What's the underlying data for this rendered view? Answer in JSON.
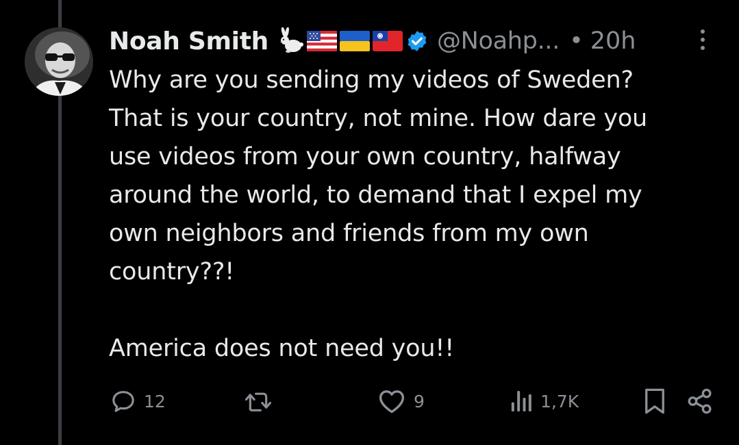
{
  "author": {
    "display_name": "Noah Smith",
    "handle": "@Noahp...",
    "separator": "•",
    "timestamp": "20h",
    "badges": [
      "rabbit-emoji",
      "us-flag",
      "ukraine-flag",
      "taiwan-flag",
      "verified-icon"
    ]
  },
  "tweet": {
    "lines": [
      "Why are you sending my videos of Sweden?",
      "That is your country, not mine. How dare you",
      "use videos from your own country, halfway",
      "around the world, to demand that I expel my",
      "own neighbors and friends from my own",
      "country??!"
    ],
    "closing": "America does not need you!!"
  },
  "actions": {
    "reply_count": "12",
    "repost_count": "",
    "like_count": "9",
    "view_count": "1,7K"
  },
  "colors": {
    "background": "#000000",
    "text": "#e7e9ea",
    "muted": "#8b9096",
    "verified": "#1d9bf0",
    "thread_line": "#3a3d41"
  }
}
